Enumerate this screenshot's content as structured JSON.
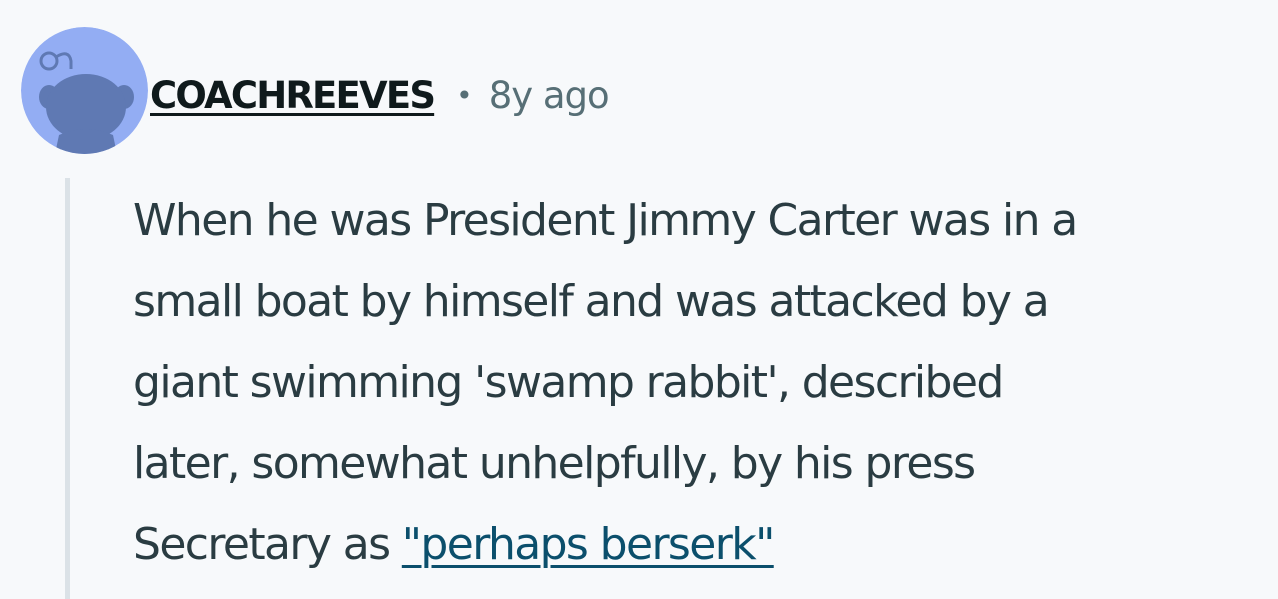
{
  "comment": {
    "author": "COACHREEVES",
    "separator": "•",
    "age": "8y ago",
    "body_lines": [
      "When he was President Jimmy Carter was in a",
      "small boat by himself and was attacked by a",
      "giant swimming 'swamp rabbit', described",
      "later, somewhat unhelpfully, by his press"
    ],
    "last_line_prefix": "Secretary as ",
    "link_text": "\"perhaps berserk\""
  },
  "avatar": {
    "icon": "snoo-avatar-icon",
    "background": "#93adf3",
    "figure": "#5f79b3"
  },
  "colors": {
    "background": "#f7f9fb",
    "username": "#0f1a1c",
    "meta": "#576f76",
    "body_text": "#2a3c42",
    "link": "#0b4f6c",
    "thread_line": "#dbe2e7"
  }
}
